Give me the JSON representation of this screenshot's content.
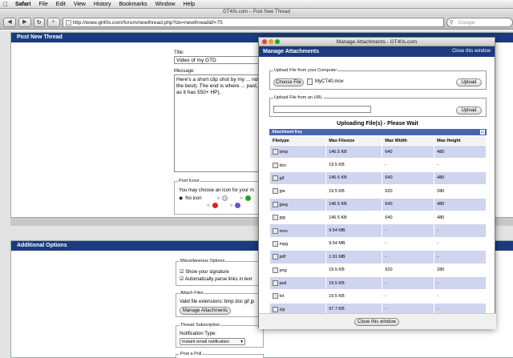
{
  "menubar": {
    "app": "Safari",
    "items": [
      "File",
      "Edit",
      "View",
      "History",
      "Bookmarks",
      "Window",
      "Help"
    ]
  },
  "browser": {
    "window_title": "GT40s.com – Post New Thread",
    "url": "http://www.gt40s.com/forum/newthread.php?do=newthread&f=75",
    "search_placeholder": "Google"
  },
  "post": {
    "header": "Post New Thread",
    "title_label": "Title:",
    "title_value": "Video of my GTD",
    "message_label": "Message:",
    "message_value": "Here's a short clip shot by my ... not the best). The end is where ... past, as it has 550+ HP).",
    "post_icons_legend": "Post Icons",
    "post_icons_text": "You may choose an icon for your m",
    "no_icon_label": "No icon"
  },
  "additional": {
    "header": "Additional Options",
    "misc_legend": "Miscellaneous Options",
    "show_signature": "Show your signature",
    "parse_links": "Automatically parse links in text",
    "attach_legend": "Attach Files",
    "valid_ext": "Valid file extensions: bmp doc gif jp",
    "manage_btn": "Manage Attachments",
    "sub_legend": "Thread Subscription",
    "notif_label": "Notification Type:",
    "notif_value": "Instant email notification",
    "poll_legend": "Post a Poll"
  },
  "popup": {
    "window_title": "Manage Attachments - GT40s.com",
    "header": "Manage Attachments",
    "close_link": "Close this window",
    "computer_legend": "Upload File from your Computer",
    "choose_btn": "Choose File",
    "chosen_file": "MyCT40.mov",
    "upload_btn": "Upload",
    "url_legend": "Upload File from an URL",
    "upload_btn2": "Upload",
    "uploading": "Uploading File(s) - Please Wait",
    "key_title": "Attachment Key",
    "columns": [
      "Filetype",
      "Max Filesize",
      "Max Width",
      "Max Height"
    ],
    "rows": [
      [
        "bmp",
        "146.5 KB",
        "640",
        "480"
      ],
      [
        "doc",
        "19.5 KB",
        "-",
        "-"
      ],
      [
        "gif",
        "146.5 KB",
        "640",
        "480"
      ],
      [
        "jpe",
        "19.5 KB",
        "620",
        "280"
      ],
      [
        "jpeg",
        "146.5 KB",
        "640",
        "480"
      ],
      [
        "jpg",
        "146.5 KB",
        "640",
        "480"
      ],
      [
        "mov",
        "9.54 MB",
        "-",
        "-"
      ],
      [
        "mpg",
        "9.54 MB",
        "-",
        "-"
      ],
      [
        "pdf",
        "1.91 MB",
        "-",
        "-"
      ],
      [
        "png",
        "19.5 KB",
        "620",
        "280"
      ],
      [
        "psd",
        "19.5 KB",
        "-",
        "-"
      ],
      [
        "txt",
        "19.5 KB",
        "-",
        "-"
      ],
      [
        "zip",
        "97.7 KB",
        "-",
        "-"
      ]
    ],
    "bottom_close_btn": "Close this window"
  },
  "colors": {
    "header_blue": "#1b3a7f",
    "row_alt": "#cfd4ef"
  }
}
